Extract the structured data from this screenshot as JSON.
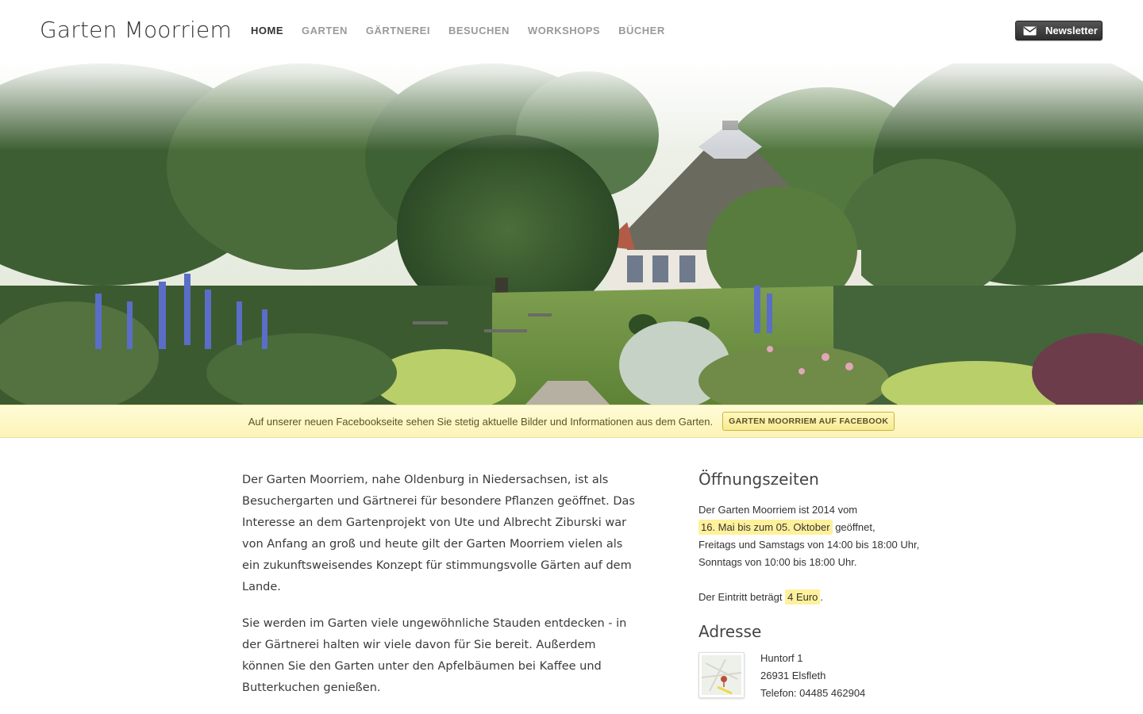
{
  "header": {
    "site_title": "Garten Moorriem",
    "nav": [
      {
        "label": "HOME",
        "active": true
      },
      {
        "label": "GARTEN",
        "active": false
      },
      {
        "label": "GÄRTNEREI",
        "active": false
      },
      {
        "label": "BESUCHEN",
        "active": false
      },
      {
        "label": "WORKSHOPS",
        "active": false
      },
      {
        "label": "BÜCHER",
        "active": false
      }
    ],
    "newsletter_label": "Newsletter",
    "newsletter_icon": "envelope-icon"
  },
  "notice": {
    "text": "Auf unserer neuen Facebookseite sehen Sie stetig aktuelle Bilder und Informationen aus dem Garten.",
    "button_label": "GARTEN MOORRIEM AUF FACEBOOK"
  },
  "main": {
    "paragraphs": [
      "Der Garten Moorriem, nahe Oldenburg in Niedersachsen, ist als Besuchergarten und Gärtnerei für besondere Pflanzen geöffnet. Das Interesse an dem Gartenprojekt von Ute und Albrecht Ziburski war von Anfang an groß und heute gilt der Garten Moorriem vielen als ein zukunftsweisendes Konzept für stimmungsvolle Gärten auf dem Lande.",
      "Sie werden im Garten viele ungewöhnliche Stauden entdecken - in der Gärtnerei halten wir viele davon für Sie bereit. Außerdem können Sie den Garten unter den Apfelbäumen bei Kaffee und Butterkuchen genießen."
    ]
  },
  "sidebar": {
    "hours_title": "Öffnungszeiten",
    "hours_intro": "Der Garten Moorriem ist 2014 vom",
    "hours_range": "16. Mai bis zum 05. Oktober",
    "hours_range_suffix": " geöffnet,",
    "hours_fri_sat": "Freitags und Samstags von 14:00 bis 18:00 Uhr,",
    "hours_sun": "Sonntags von 10:00 bis 18:00 Uhr.",
    "entry_prefix": "Der Eintritt beträgt ",
    "entry_price": "4 Euro",
    "entry_suffix": ".",
    "address_title": "Adresse",
    "address_lines": [
      "Huntorf 1",
      "26931 Elsfleth",
      "Telefon: 04485 462904"
    ]
  },
  "colors": {
    "notice_bg": "#fdf4b8",
    "highlight": "#fff19c",
    "newsletter_bg": "#333333"
  }
}
